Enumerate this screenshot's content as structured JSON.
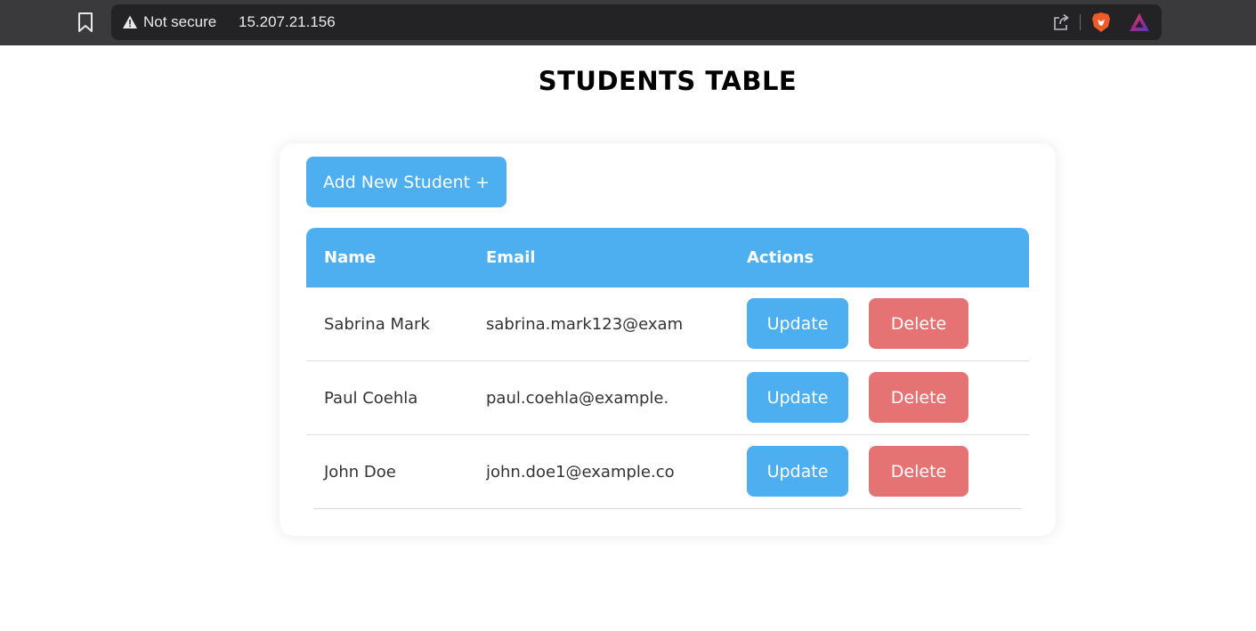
{
  "browser": {
    "security_label": "Not secure",
    "url": "15.207.21.156"
  },
  "page": {
    "title": "STUDENTS TABLE",
    "add_button_label": "Add New Student +"
  },
  "table": {
    "columns": [
      "Name",
      "Email",
      "Actions"
    ],
    "rows": [
      {
        "name": "Sabrina Mark",
        "email": "sabrina.mark123@exam",
        "update_label": "Update",
        "delete_label": "Delete"
      },
      {
        "name": "Paul Coehla",
        "email": "paul.coehla@example.",
        "update_label": "Update",
        "delete_label": "Delete"
      },
      {
        "name": "John Doe",
        "email": "john.doe1@example.co",
        "update_label": "Update",
        "delete_label": "Delete"
      }
    ]
  },
  "colors": {
    "primary": "#4daef0",
    "danger": "#e57373",
    "chrome_bg": "#3a3a3c",
    "omnibox_bg": "#232325"
  },
  "icons": [
    "bookmark-icon",
    "warning-icon",
    "share-icon",
    "brave-shield-icon",
    "brave-rewards-icon"
  ]
}
